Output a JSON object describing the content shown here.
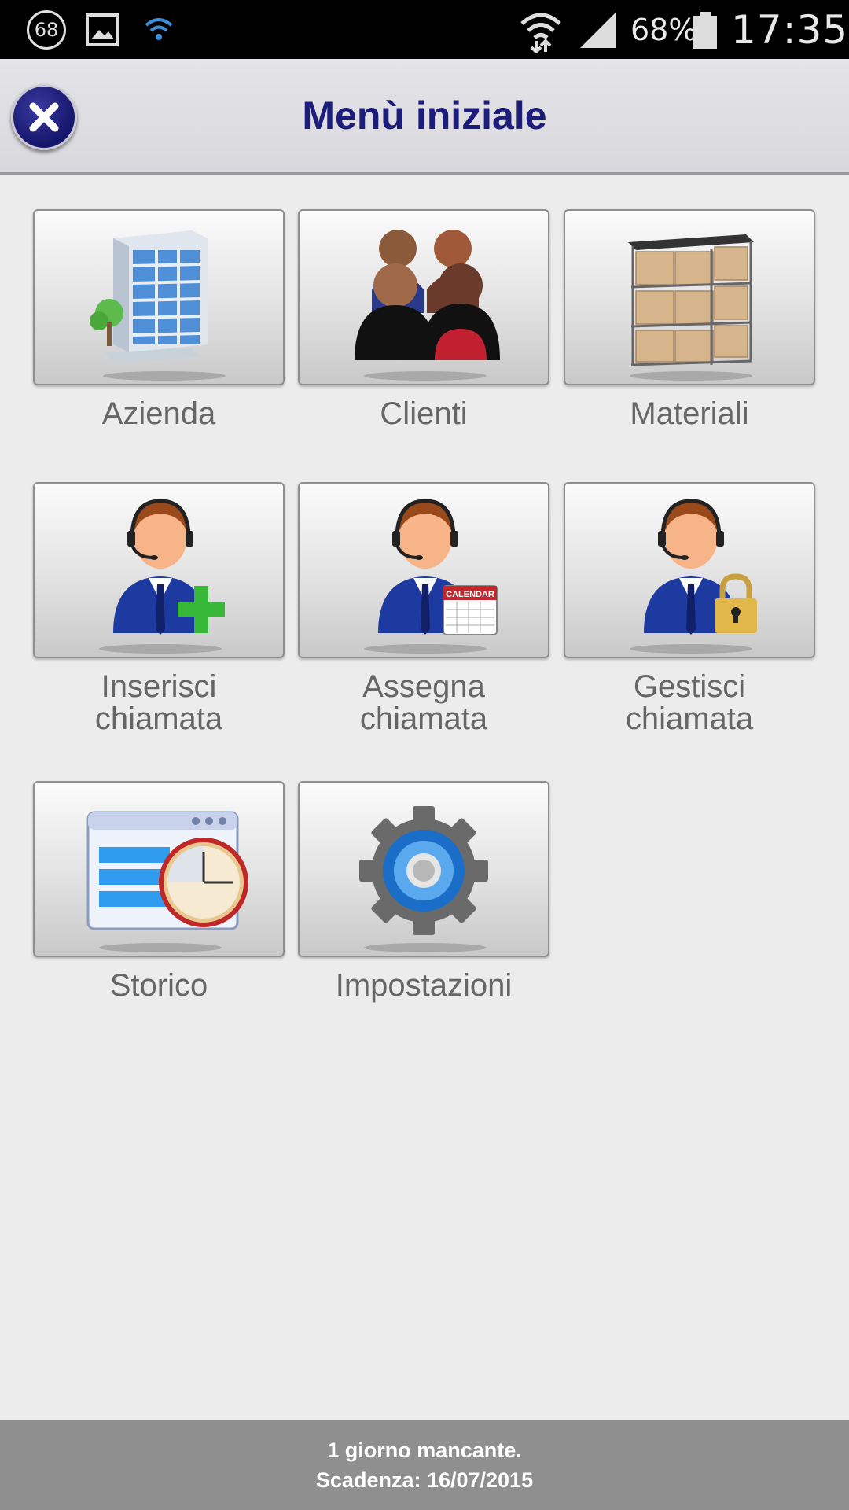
{
  "status_bar": {
    "notification_count": "68",
    "battery_percent": "68%",
    "time": "17:35",
    "icons": [
      "notification-badge-icon",
      "gallery-icon",
      "wifi-icon",
      "wifi-signal-icon",
      "cell-signal-icon",
      "battery-icon"
    ]
  },
  "header": {
    "title": "Menù iniziale",
    "close_icon": "close-icon",
    "colors": {
      "title": "#1c1c7a",
      "close_button": "#1a1a6e"
    }
  },
  "menu": {
    "items": [
      {
        "label": "Azienda",
        "icon": "office-building-icon"
      },
      {
        "label": "Clienti",
        "icon": "people-group-icon"
      },
      {
        "label": "Materiali",
        "icon": "warehouse-shelf-icon"
      },
      {
        "label": "Inserisci chiamata",
        "icon": "operator-add-icon"
      },
      {
        "label": "Assegna chiamata",
        "icon": "operator-calendar-icon"
      },
      {
        "label": "Gestisci chiamata",
        "icon": "operator-lock-icon"
      },
      {
        "label": "Storico",
        "icon": "history-clock-icon"
      },
      {
        "label": "Impostazioni",
        "icon": "settings-gear-icon"
      }
    ],
    "calendar_badge_text": "CALENDAR"
  },
  "footer": {
    "line1": "1 giorno mancante.",
    "line2": "Scadenza: 16/07/2015"
  }
}
